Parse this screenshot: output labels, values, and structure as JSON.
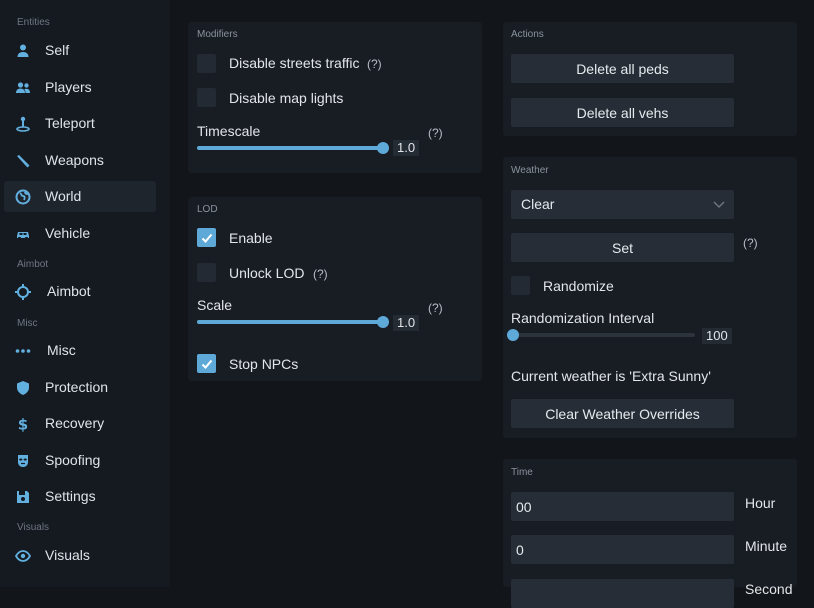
{
  "sidebar": {
    "sections": [
      {
        "label": "Entities",
        "items": [
          {
            "label": "Self",
            "icon": "person-icon"
          },
          {
            "label": "Players",
            "icon": "players-icon"
          },
          {
            "label": "Teleport",
            "icon": "teleport-icon"
          },
          {
            "label": "Weapons",
            "icon": "weapon-icon"
          },
          {
            "label": "World",
            "icon": "globe-icon",
            "active": true
          },
          {
            "label": "Vehicle",
            "icon": "car-icon"
          }
        ]
      },
      {
        "label": "Aimbot",
        "items": [
          {
            "label": "Aimbot",
            "icon": "crosshair-icon"
          }
        ]
      },
      {
        "label": "Misc",
        "items": [
          {
            "label": "Misc",
            "icon": "ellipsis-icon"
          },
          {
            "label": "Protection",
            "icon": "shield-icon"
          },
          {
            "label": "Recovery",
            "icon": "dollar-icon"
          },
          {
            "label": "Spoofing",
            "icon": "mask-icon"
          },
          {
            "label": "Settings",
            "icon": "save-icon"
          }
        ]
      },
      {
        "label": "Visuals",
        "items": [
          {
            "label": "Visuals",
            "icon": "eye-icon"
          }
        ]
      }
    ]
  },
  "modifiers": {
    "title": "Modifiers",
    "disable_traffic": {
      "label": "Disable streets traffic",
      "help": "(?)",
      "checked": false
    },
    "disable_lights": {
      "label": "Disable map lights",
      "checked": false
    },
    "timescale": {
      "label": "Timescale",
      "help": "(?)",
      "value": "1.0",
      "fraction": 1.0
    }
  },
  "lod": {
    "title": "LOD",
    "enable": {
      "label": "Enable",
      "checked": true
    },
    "unlock": {
      "label": "Unlock LOD",
      "help": "(?)",
      "checked": false
    },
    "scale": {
      "label": "Scale",
      "help": "(?)",
      "value": "1.0",
      "fraction": 1.0
    },
    "stop_npcs": {
      "label": "Stop NPCs",
      "checked": true
    }
  },
  "actions": {
    "title": "Actions",
    "delete_peds": "Delete all peds",
    "delete_vehs": "Delete all vehs"
  },
  "weather": {
    "title": "Weather",
    "selected": "Clear",
    "set_label": "Set",
    "set_help": "(?)",
    "randomize": {
      "label": "Randomize",
      "checked": false
    },
    "interval": {
      "label": "Randomization Interval",
      "value": "100",
      "fraction": 0.0
    },
    "current": "Current weather is 'Extra Sunny'",
    "clear_overrides": "Clear Weather Overrides"
  },
  "time": {
    "title": "Time",
    "hour": {
      "value": "00",
      "label": "Hour"
    },
    "minute": {
      "value": "0",
      "label": "Minute"
    },
    "second": {
      "label": "Second"
    }
  },
  "colors": {
    "accent": "#5ea9d8",
    "panel": "#181c23",
    "background": "#12151a"
  }
}
